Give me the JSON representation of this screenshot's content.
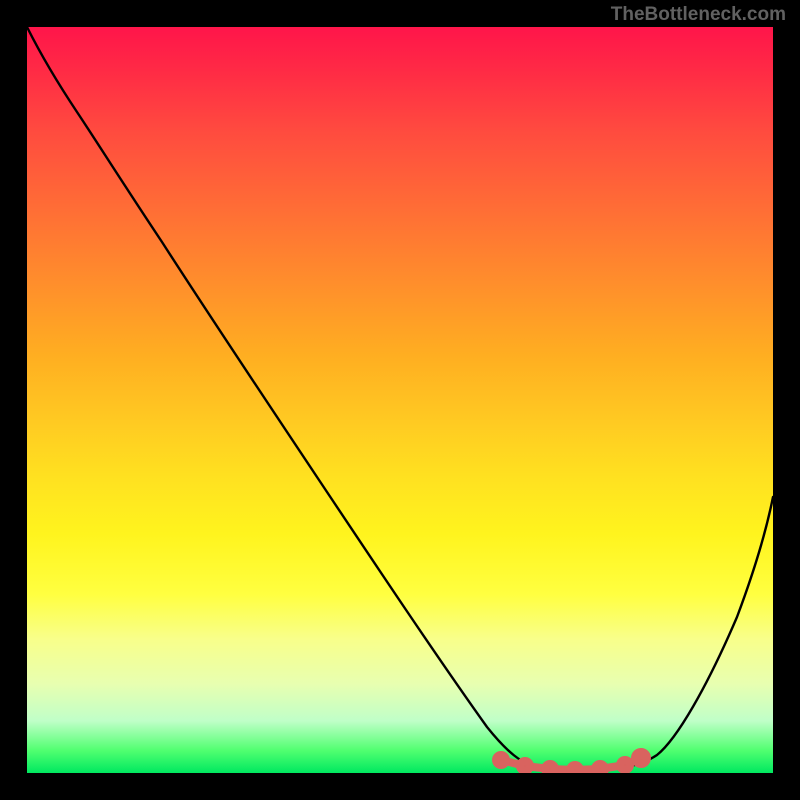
{
  "watermark": "TheBottleneck.com",
  "chart_data": {
    "type": "line",
    "title": "",
    "xlabel": "",
    "ylabel": "",
    "xlim": [
      0,
      100
    ],
    "ylim": [
      0,
      100
    ],
    "grid": false,
    "description": "Bottleneck curve on a red-to-green vertical gradient. A black curve descends from the top-left to a minimum around x≈74 (valley region x≈63–82) then rises to the right edge. Pink highlighted points lie along the valley floor.",
    "series": [
      {
        "name": "bottleneck-curve",
        "color": "#000000",
        "x": [
          0,
          3,
          6,
          10,
          15,
          20,
          25,
          30,
          35,
          40,
          45,
          50,
          55,
          60,
          63,
          66,
          70,
          74,
          78,
          82,
          85,
          88,
          92,
          96,
          100
        ],
        "y": [
          100,
          97,
          93.5,
          88,
          80,
          72.5,
          65,
          57.5,
          50,
          42.5,
          35,
          27.5,
          20,
          12.5,
          8,
          4.5,
          2,
          1.2,
          1.5,
          3.5,
          7,
          12,
          20,
          30,
          40
        ]
      },
      {
        "name": "valley-highlight",
        "color": "#d9635f",
        "x": [
          63,
          66,
          70,
          74,
          78,
          82
        ],
        "y": [
          4.2,
          3,
          2.2,
          1.6,
          1.8,
          2.8
        ]
      }
    ],
    "gradient_stops": [
      {
        "pos": 0,
        "color": "#ff154a"
      },
      {
        "pos": 50,
        "color": "#ffc020"
      },
      {
        "pos": 80,
        "color": "#ffff60"
      },
      {
        "pos": 100,
        "color": "#00e860"
      }
    ]
  }
}
